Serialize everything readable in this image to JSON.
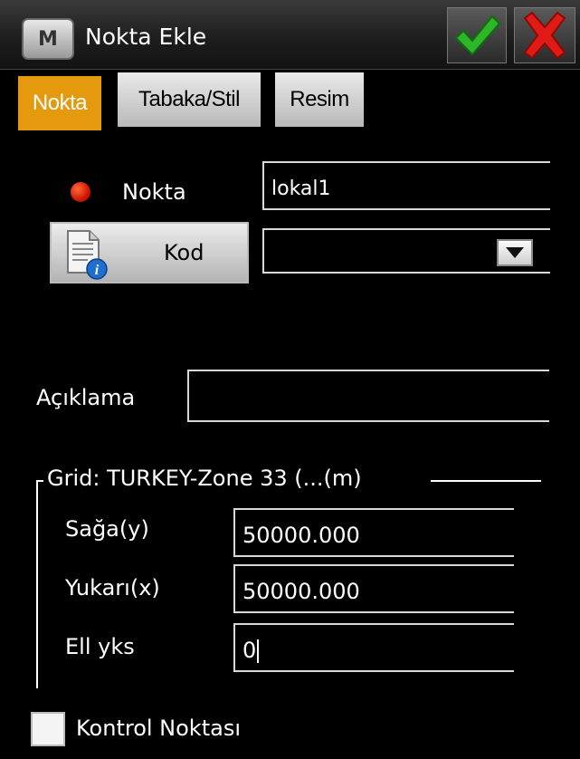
{
  "window": {
    "app_icon_letter": "M",
    "title": "Nokta Ekle",
    "ok_icon": "checkmark-icon",
    "cancel_icon": "close-icon"
  },
  "tabs": [
    {
      "label": "Nokta",
      "active": true
    },
    {
      "label": "Tabaka/Stil",
      "active": false
    },
    {
      "label": "Resim",
      "active": false
    }
  ],
  "form": {
    "point_label": "Nokta",
    "point_value": "lokal1",
    "code_button_label": "Kod",
    "code_value": "",
    "description_label": "Açıklama",
    "description_value": ""
  },
  "grid": {
    "title": "Grid: TURKEY-Zone 33 (...(m)",
    "fields": [
      {
        "label": "Sağa(y)",
        "value": "50000.000"
      },
      {
        "label": "Yukarı(x)",
        "value": "50000.000"
      },
      {
        "label": "Ell yks",
        "value": "0"
      }
    ]
  },
  "control_point": {
    "label": "Kontrol Noktası",
    "checked": false
  },
  "colors": {
    "active_tab": "#e59a0e",
    "point_dot": "#d01800"
  }
}
